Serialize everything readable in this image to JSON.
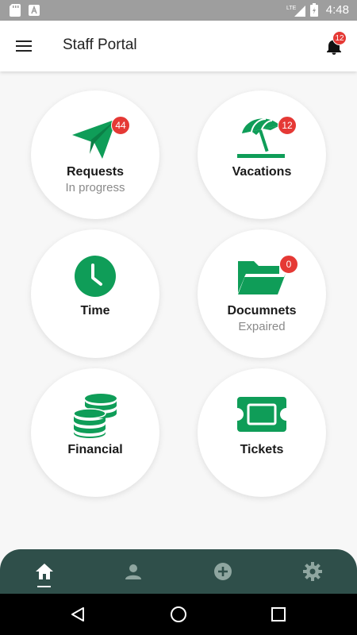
{
  "status_bar": {
    "time": "4:48",
    "network": "LTE"
  },
  "app_bar": {
    "title": "Staff Portal",
    "notification_count": "12"
  },
  "tiles": [
    {
      "label": "Requests",
      "subtitle": "In progress",
      "badge": "44",
      "icon": "paper-plane-icon"
    },
    {
      "label": "Vacations",
      "subtitle": "",
      "badge": "12",
      "icon": "beach-umbrella-icon"
    },
    {
      "label": "Time",
      "subtitle": "",
      "badge": "",
      "icon": "clock-icon"
    },
    {
      "label": "Documnets",
      "subtitle": "Expaired",
      "badge": "0",
      "icon": "folder-open-icon"
    },
    {
      "label": "Financial",
      "subtitle": "",
      "badge": "",
      "icon": "coins-icon"
    },
    {
      "label": "Tickets",
      "subtitle": "",
      "badge": "",
      "icon": "ticket-icon"
    }
  ],
  "bottom_nav": {
    "items": [
      "home-icon",
      "person-icon",
      "add-circle-icon",
      "settings-icon"
    ],
    "active": "home-icon"
  },
  "colors": {
    "accent": "#0f9d58",
    "badge": "#e53935",
    "nav_bg": "#2f4f4a"
  }
}
